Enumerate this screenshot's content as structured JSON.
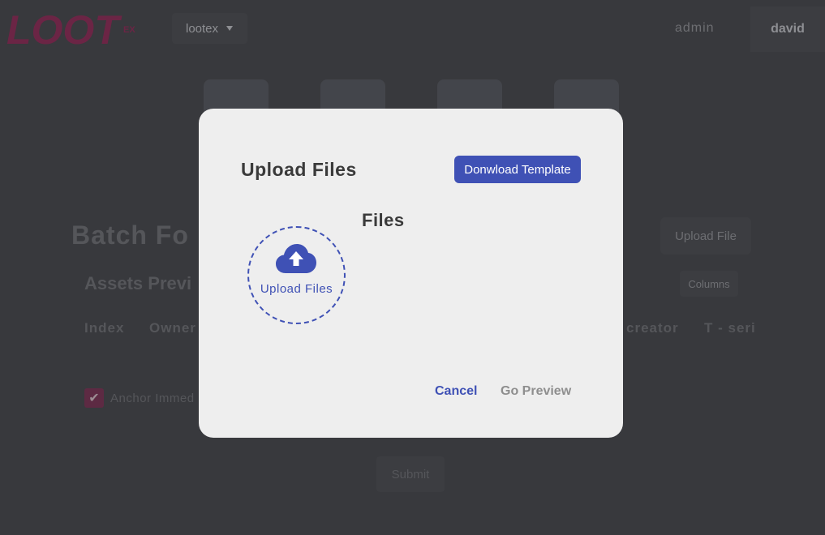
{
  "header": {
    "logo_text": "LOOT",
    "logo_suffix": "EX",
    "org_select": "lootex",
    "nav_admin": "admin",
    "nav_user": "david"
  },
  "page": {
    "title": "Batch Fo",
    "subhead": "Assets Previ",
    "upload_file_label": "Upload File",
    "columns_label": "Columns",
    "table_headers": [
      "Index",
      "Owner",
      "creator",
      "T - seri"
    ],
    "anchor_label": "Anchor Immed",
    "submit_label": "Submit"
  },
  "modal": {
    "title": "Upload Files",
    "download_template_label": "Donwload Template",
    "drop_zone_label": "Upload Files",
    "drop_zone_icon": "cloud-upload-icon",
    "files_heading": "Files",
    "cancel_label": "Cancel",
    "go_preview_label": "Go Preview"
  },
  "colors": {
    "accent": "#3f51b5",
    "overlay_bg": "#38393d",
    "modal_bg": "#eeeeee",
    "brand": "#7a2a4d"
  }
}
